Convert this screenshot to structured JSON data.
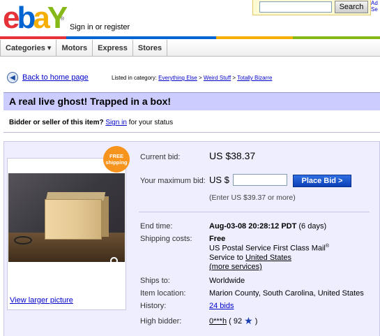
{
  "header": {
    "logo": {
      "e": "e",
      "b": "b",
      "a": "a",
      "y": "Y",
      "tm": "®"
    },
    "signin_text": "Sign in or register",
    "search_button": "Search",
    "adv_text": "Ad Se"
  },
  "brand_colors": [
    "#e53238",
    "#0064d2",
    "#f5af02",
    "#86b817"
  ],
  "nav": {
    "categories": "Categories ▾",
    "motors": "Motors",
    "express": "Express",
    "stores": "Stores"
  },
  "back": {
    "icon": "back-arrow-icon",
    "label": "Back to home page"
  },
  "breadcrumb": {
    "prefix": "Listed in category:",
    "items": [
      "Everything Else",
      "Weird Stuff",
      "Totally Bizarre"
    ],
    "sep": " > "
  },
  "item": {
    "title": "A real live ghost! Trapped in a box!",
    "status_bold": "Bidder or seller of this item?",
    "status_link": "Sign in",
    "status_rest": "for your status",
    "free_badge_line1": "FREE",
    "free_badge_line2": "shipping",
    "view_larger": "View larger picture"
  },
  "bid": {
    "current_label": "Current bid:",
    "current_value": "US $38.37",
    "max_label": "Your maximum bid:",
    "currency_prefix": "US $",
    "input_value": "",
    "place_bid": "Place Bid >",
    "enter_note": "(Enter US $39.37 or more)"
  },
  "details": {
    "end_time_label": "End time:",
    "end_time_value": "Aug-03-08 20:28:12 PDT",
    "end_time_left": "(6 days)",
    "shipping_label": "Shipping costs:",
    "shipping_cost": "Free",
    "shipping_service": "US Postal Service First Class Mail",
    "shipping_reg": "®",
    "service_to": "Service to",
    "service_dest": "United States",
    "more_services": "(more services)",
    "ships_to_label": "Ships to:",
    "ships_to_value": "Worldwide",
    "location_label": "Item location:",
    "location_value": "Marion County, South Carolina, United States",
    "history_label": "History:",
    "history_value": "24 bids",
    "high_bidder_label": "High bidder:",
    "high_bidder_name": "0***h",
    "high_bidder_score_open": "( 92",
    "high_bidder_score_close": ")"
  }
}
